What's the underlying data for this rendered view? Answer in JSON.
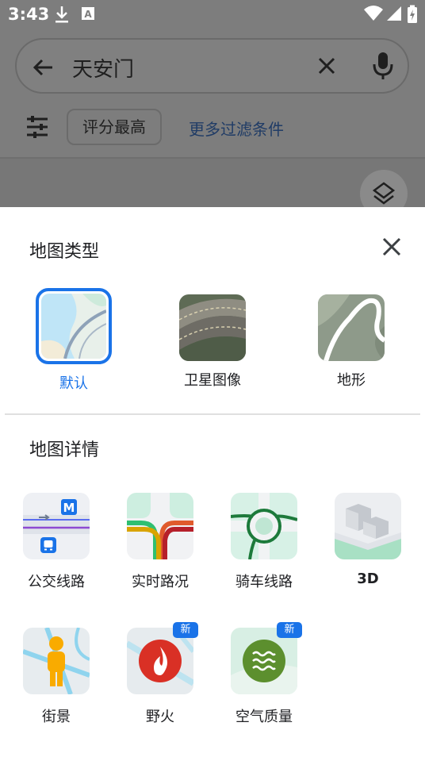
{
  "status_bar": {
    "time": "3:43"
  },
  "search": {
    "query": "天安门"
  },
  "filters": {
    "chip_label": "评分最高",
    "more_label": "更多过滤条件"
  },
  "sheet": {
    "map_type_title": "地图类型",
    "map_types": [
      {
        "label": "默认",
        "selected": true
      },
      {
        "label": "卫星图像",
        "selected": false
      },
      {
        "label": "地形",
        "selected": false
      }
    ],
    "map_details_title": "地图详情",
    "details": [
      {
        "label": "公交线路",
        "new": false
      },
      {
        "label": "实时路况",
        "new": false
      },
      {
        "label": "骑车线路",
        "new": false
      },
      {
        "label": "3D",
        "new": false
      },
      {
        "label": "街景",
        "new": false
      },
      {
        "label": "野火",
        "new": true,
        "badge": "新"
      },
      {
        "label": "空气质量",
        "new": true,
        "badge": "新"
      }
    ]
  },
  "colors": {
    "accent": "#1a73e8",
    "scrim": "#7d7d7d"
  }
}
